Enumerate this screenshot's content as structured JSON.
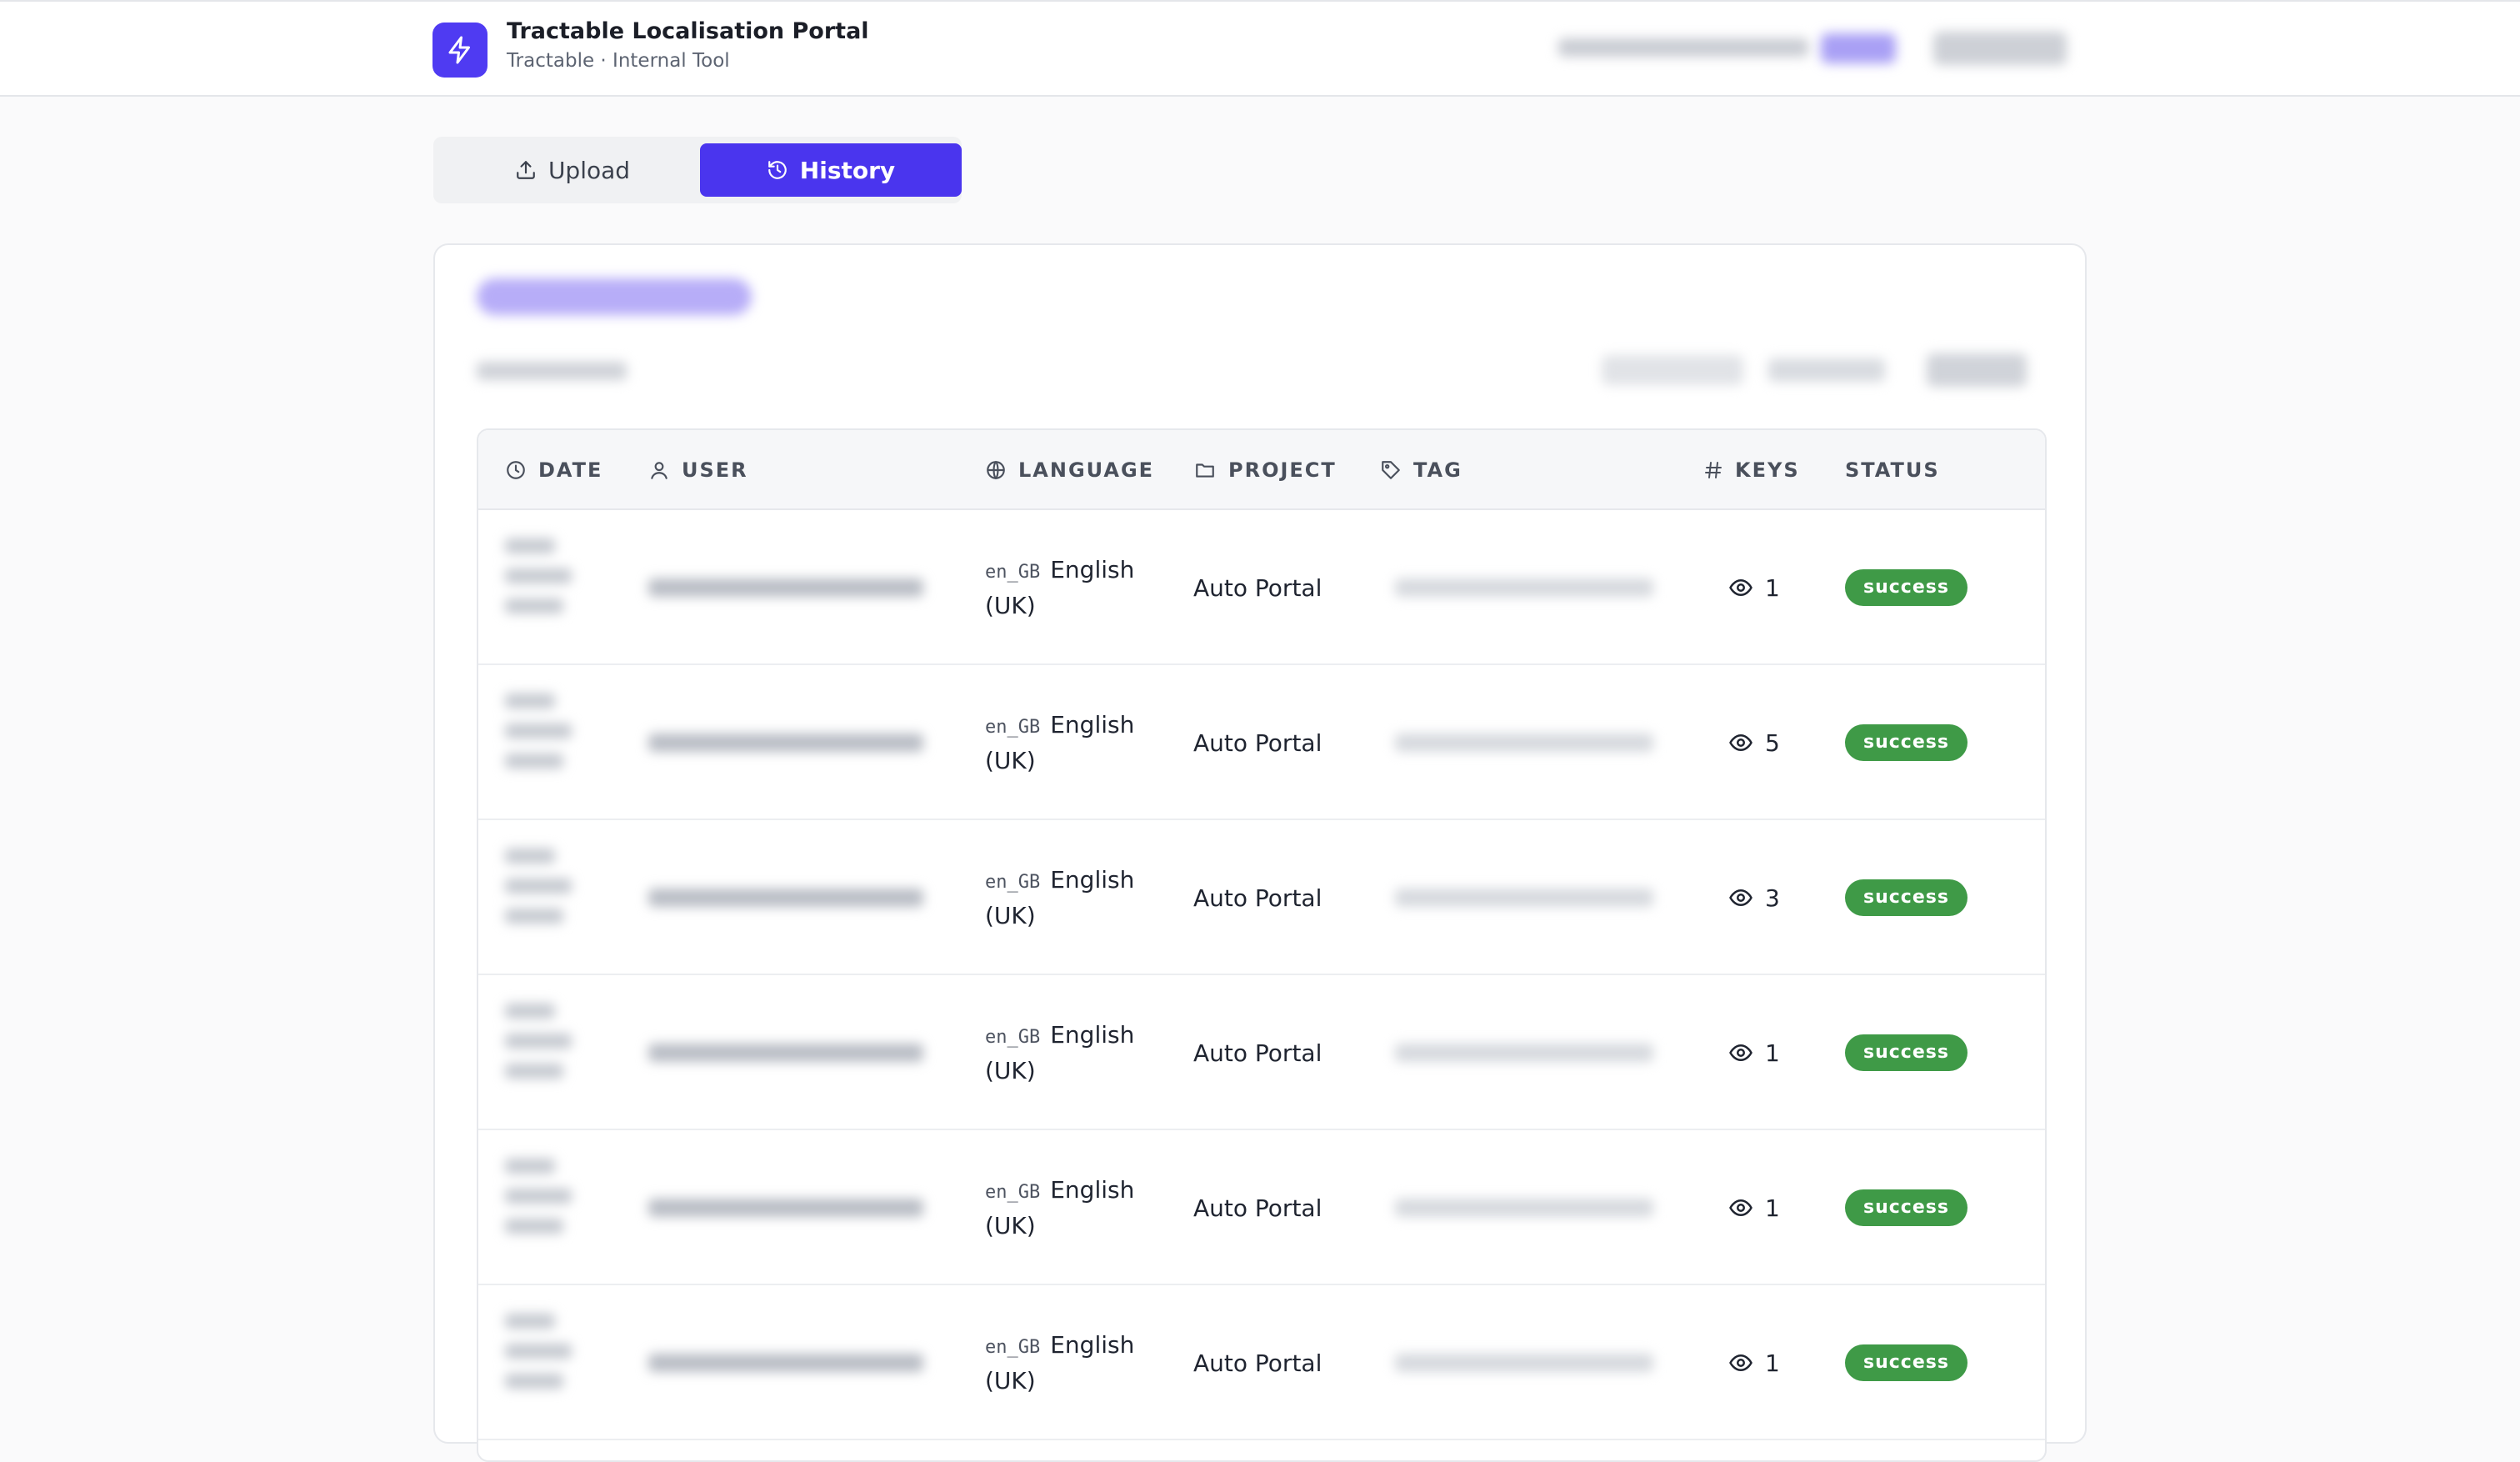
{
  "header": {
    "title": "Tractable Localisation Portal",
    "subtitle": "Tractable · Internal Tool"
  },
  "tabs": [
    {
      "label": "Upload",
      "icon": "upload-icon",
      "active": false
    },
    {
      "label": "History",
      "icon": "history-icon",
      "active": true
    }
  ],
  "colors": {
    "accent": "#4a35ee",
    "success": "#3f9a47"
  },
  "table": {
    "columns": [
      {
        "label": "DATE",
        "icon": "clock-icon"
      },
      {
        "label": "USER",
        "icon": "user-icon"
      },
      {
        "label": "LANGUAGE",
        "icon": "globe-icon"
      },
      {
        "label": "PROJECT",
        "icon": "folder-icon"
      },
      {
        "label": "TAG",
        "icon": "tag-icon"
      },
      {
        "label": "KEYS",
        "icon": "hash-icon"
      },
      {
        "label": "STATUS",
        "icon": ""
      }
    ],
    "rows": [
      {
        "language_code": "en_GB",
        "language_name": "English (UK)",
        "project": "Auto Portal",
        "keys": "1",
        "status": "success"
      },
      {
        "language_code": "en_GB",
        "language_name": "English (UK)",
        "project": "Auto Portal",
        "keys": "5",
        "status": "success"
      },
      {
        "language_code": "en_GB",
        "language_name": "English (UK)",
        "project": "Auto Portal",
        "keys": "3",
        "status": "success"
      },
      {
        "language_code": "en_GB",
        "language_name": "English (UK)",
        "project": "Auto Portal",
        "keys": "1",
        "status": "success"
      },
      {
        "language_code": "en_GB",
        "language_name": "English (UK)",
        "project": "Auto Portal",
        "keys": "1",
        "status": "success"
      },
      {
        "language_code": "en_GB",
        "language_name": "English (UK)",
        "project": "Auto Portal",
        "keys": "1",
        "status": "success"
      }
    ]
  }
}
